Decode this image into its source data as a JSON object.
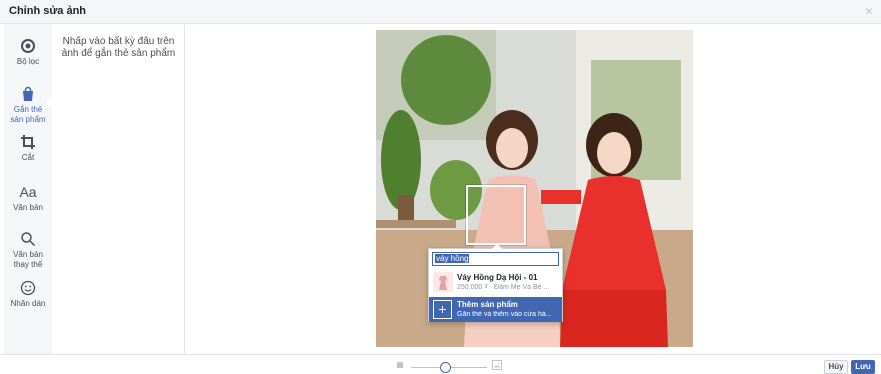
{
  "dialog": {
    "title": "Chỉnh sửa ảnh",
    "close_glyph": "×"
  },
  "sidebar": {
    "items": [
      {
        "label": "Bộ lọc",
        "icon": "filter-icon",
        "active": false
      },
      {
        "label": "Gắn thẻ\nsản phẩm",
        "icon": "shopping-bag-icon",
        "active": true
      },
      {
        "label": "Cắt",
        "icon": "crop-icon",
        "active": false
      },
      {
        "label": "Văn bản",
        "icon": "text-icon",
        "glyph": "Aa",
        "active": false
      },
      {
        "label": "Văn bản\nthay thế",
        "icon": "search-icon",
        "active": false
      },
      {
        "label": "Nhãn dán",
        "icon": "sticker-icon",
        "active": false
      }
    ]
  },
  "instruction": {
    "text": "Nhấp vào bất kỳ đâu trên ảnh để gắn thẻ sản phẩm"
  },
  "tag_popup": {
    "input_value": "váy hồng",
    "result": {
      "name": "Váy Hồng Dạ Hội - 01",
      "meta": "250.000 ₫ · Đầm Mẹ Và Bé ..."
    },
    "add_product": {
      "plus_glyph": "+",
      "title": "Thêm sản phẩm",
      "subtitle": "Gắn thẻ và thêm vào cửa hà..."
    }
  },
  "footer": {
    "zoom_level": 0.45,
    "cancel_label": "Hủy",
    "save_label": "Lưu"
  },
  "colors": {
    "accent": "#4267b2",
    "sidebar_bg": "#f5f6f7"
  }
}
